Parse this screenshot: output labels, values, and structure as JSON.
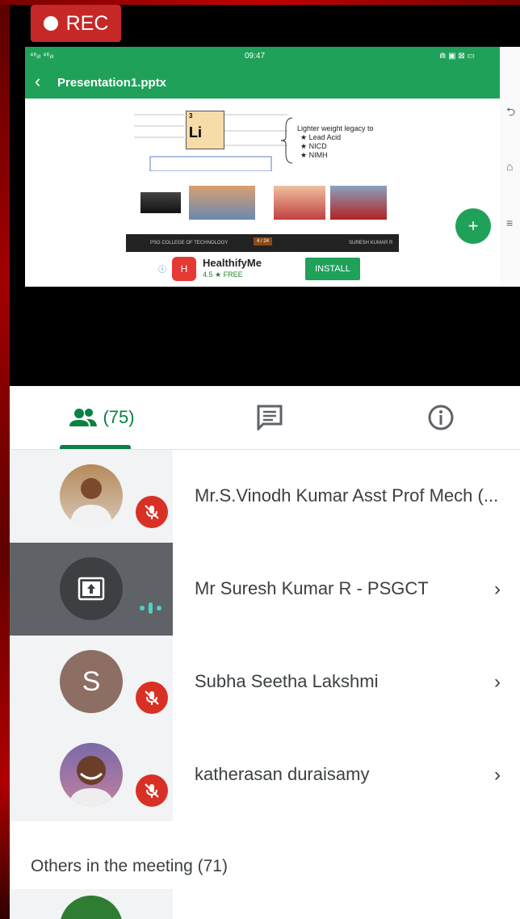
{
  "recording": {
    "label": "REC"
  },
  "shared_screen": {
    "statusbar": {
      "left": "⁴⁶ᵢₗₗ ⁴⁶ᵢₗₗ",
      "time": "09:47",
      "right": "⋒ ▣ ⊠ ▭"
    },
    "app": {
      "title": "Presentation1.pptx"
    },
    "slide": {
      "element_symbol": "Li",
      "element_number": "3",
      "legacy_title": "Lighter weight legacy to",
      "legacy_items": [
        "★ Lead Acid",
        "★ NICD",
        "★ NIMH"
      ],
      "footer_left": "PSG COLLEGE OF TECHNOLOGY",
      "footer_page": "4 / 24",
      "footer_right": "SURESH KUMAR R"
    },
    "fab_label": "+",
    "ad": {
      "name": "HealthifyMe",
      "rating": "4.5 ★ FREE",
      "install": "INSTALL"
    }
  },
  "tabs": {
    "people_count": "(75)"
  },
  "participants": [
    {
      "name": "Mr.S.Vinodh Kumar Asst Prof Mech (..."
    },
    {
      "name": "Mr Suresh Kumar R - PSGCT"
    },
    {
      "name": "Subha Seetha Lakshmi",
      "initial": "S"
    },
    {
      "name": "katherasan duraisamy"
    }
  ],
  "others": {
    "label": "Others in the meeting (71)"
  },
  "colors": {
    "accent": "#0b8043",
    "mic_off": "#d93025",
    "rec": "#c62828"
  }
}
